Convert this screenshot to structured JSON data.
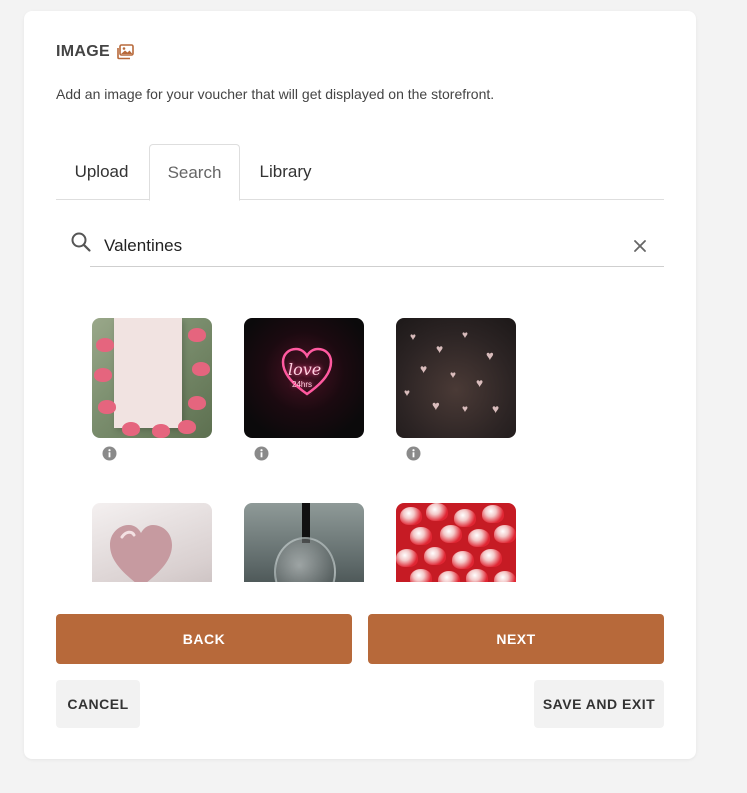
{
  "section": {
    "title": "IMAGE",
    "title_icon": "images-icon",
    "description": "Add an image for your voucher that will get displayed on the storefront."
  },
  "tabs": [
    {
      "label": "Upload",
      "active": false
    },
    {
      "label": "Search",
      "active": true
    },
    {
      "label": "Library",
      "active": false
    }
  ],
  "search": {
    "value": "Valentines",
    "icon": "search-icon",
    "clear_icon": "close-icon"
  },
  "results": [
    {
      "subject": "pink tulips around blank card",
      "info_icon": "info-icon"
    },
    {
      "subject": "neon love 24hrs heart sign",
      "info_icon": "info-icon"
    },
    {
      "subject": "heart-shaped bokeh lights",
      "info_icon": "info-icon"
    },
    {
      "subject": "pink heart balloon",
      "info_icon": "info-icon"
    },
    {
      "subject": "glass light bulb",
      "info_icon": "info-icon"
    },
    {
      "subject": "red heart gummies",
      "info_icon": "info-icon"
    }
  ],
  "actions": {
    "back": "BACK",
    "next": "NEXT",
    "cancel": "CANCEL",
    "save_and_exit": "SAVE AND EXIT"
  },
  "colors": {
    "accent": "#b7693a",
    "background": "#f3f3f3",
    "card": "#ffffff",
    "secondary_button": "#f2f2f2"
  }
}
